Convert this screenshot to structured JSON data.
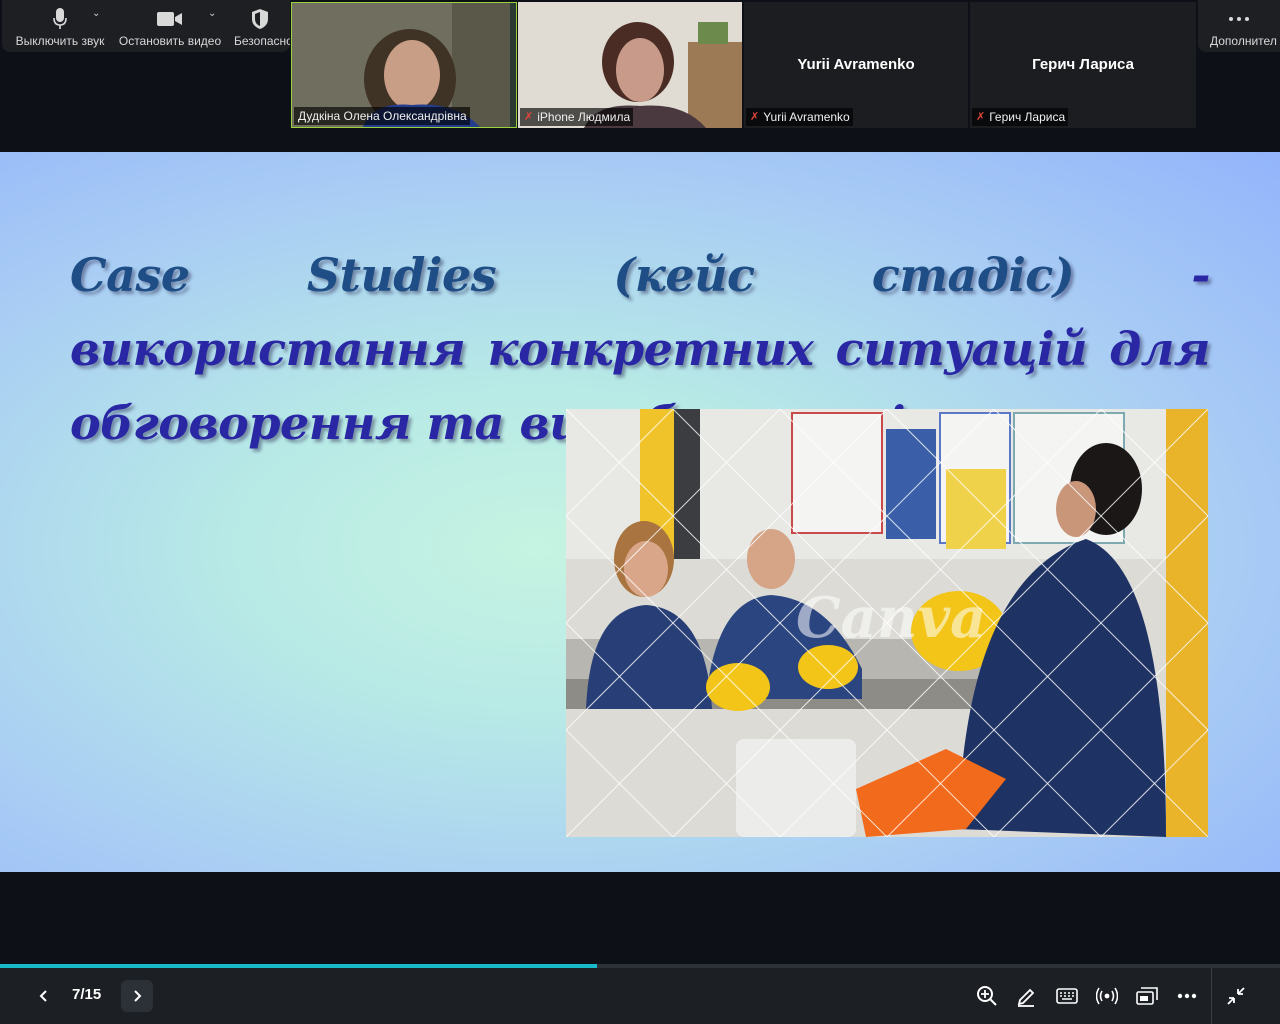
{
  "toolbar": {
    "mute_label": "Выключить звук",
    "video_label": "Остановить видео",
    "security_label": "Безопасно",
    "more_label": "Дополнител"
  },
  "participants": [
    {
      "name": "Дудкіна Олена Олександрівна",
      "muted": false,
      "active_speaker": true
    },
    {
      "name": "iPhone Людмила",
      "muted": true
    },
    {
      "name": "Yurii Avramenko",
      "display": "Yurii Avramenko",
      "muted": true
    },
    {
      "name": "Герич Лариса",
      "display": "Герич Лариса",
      "muted": true
    }
  ],
  "slide": {
    "title_part1": "Case Studies (кейс стадіс)",
    "title_part2": " - використання конкретних ситуацій для обговорення та вироблення рішень.",
    "watermark": "Canva"
  },
  "presentation": {
    "page_indicator": "7/15",
    "current_page": 7,
    "total_pages": 15
  },
  "colors": {
    "accent": "#19b9c9",
    "title_text": "#2a27a5",
    "muted_icon": "#e0453a",
    "active_speaker_border": "#9bd13b"
  },
  "icons": {
    "bottom_right": [
      "zoom-in-icon",
      "annotate-pen-icon",
      "keyboard-icon",
      "broadcast-icon",
      "switch-view-icon",
      "more-icon",
      "exit-fullscreen-icon"
    ]
  }
}
